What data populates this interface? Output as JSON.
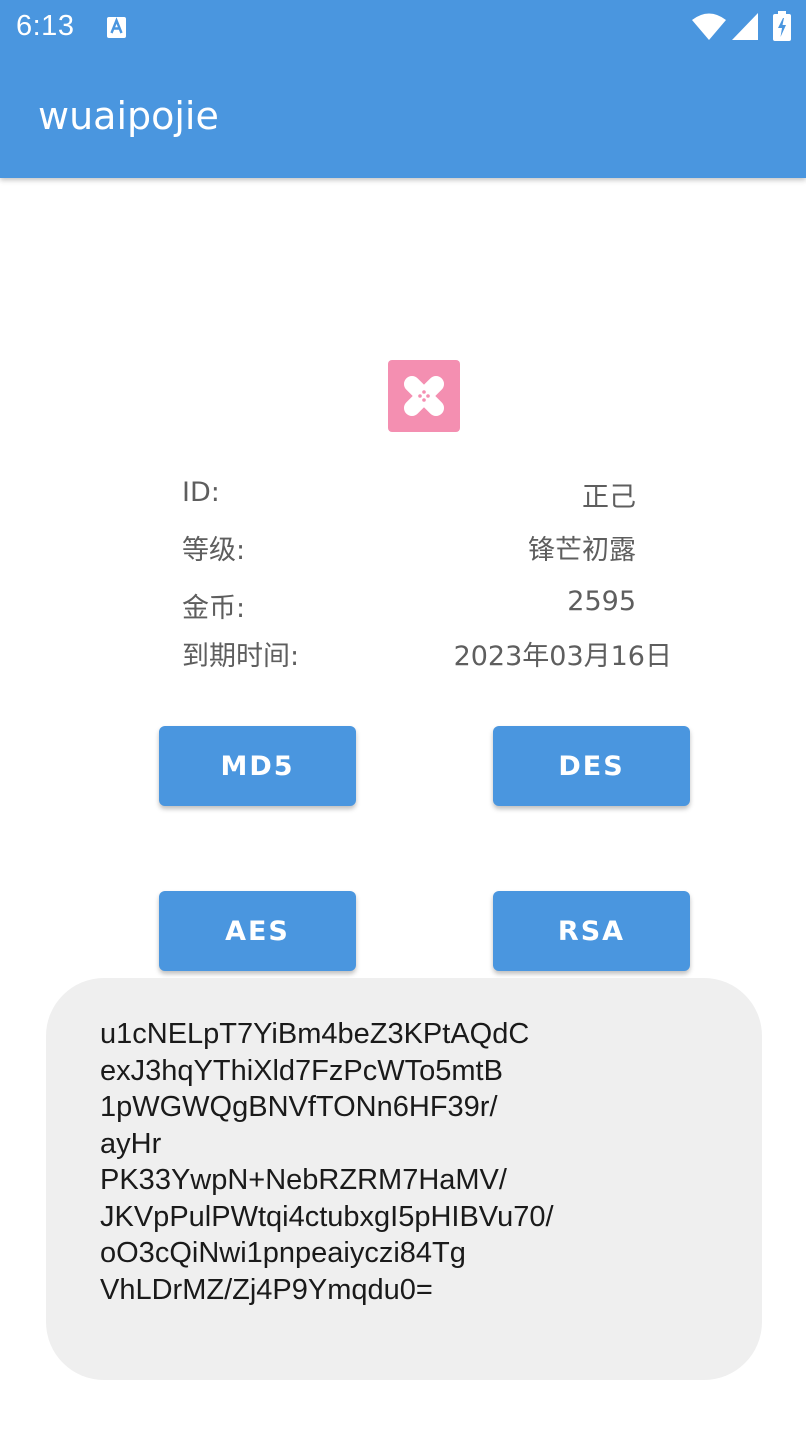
{
  "status_bar": {
    "time": "6:13",
    "icons": [
      "text-a-icon",
      "wifi-icon",
      "signal-icon",
      "battery-charging-icon"
    ]
  },
  "app_bar": {
    "title": "wuaipojie"
  },
  "logo": {
    "icon": "bandage-icon",
    "color": "#f48fb1"
  },
  "info": {
    "id_label": "ID:",
    "id_value": "正己",
    "level_label": "等级:",
    "level_value": "锋芒初露",
    "coins_label": "金币:",
    "coins_value": "2595",
    "expiry_label": "到期时间:",
    "expiry_value": "2023年03月16日"
  },
  "buttons": {
    "md5": "MD5",
    "des": "DES",
    "aes": "AES",
    "rsa": "RSA"
  },
  "output": {
    "text": "u1cNELpT7YiBm4beZ3KPtAQdC\nexJ3hqYThiXld7FzPcWTo5mtB\n1pWGWQgBNVfTONn6HF39r/\nayHr\nPK33YwpN+NebRZRM7HaMV/\nJKVpPulPWtqi4ctubxgI5pHIBVu70/\noO3cQiNwi1pnpeaiyczi84Tg\nVhLDrMZ/Zj4P9Ymqdu0="
  },
  "colors": {
    "primary": "#4a96df",
    "output_bg": "#efefef"
  }
}
